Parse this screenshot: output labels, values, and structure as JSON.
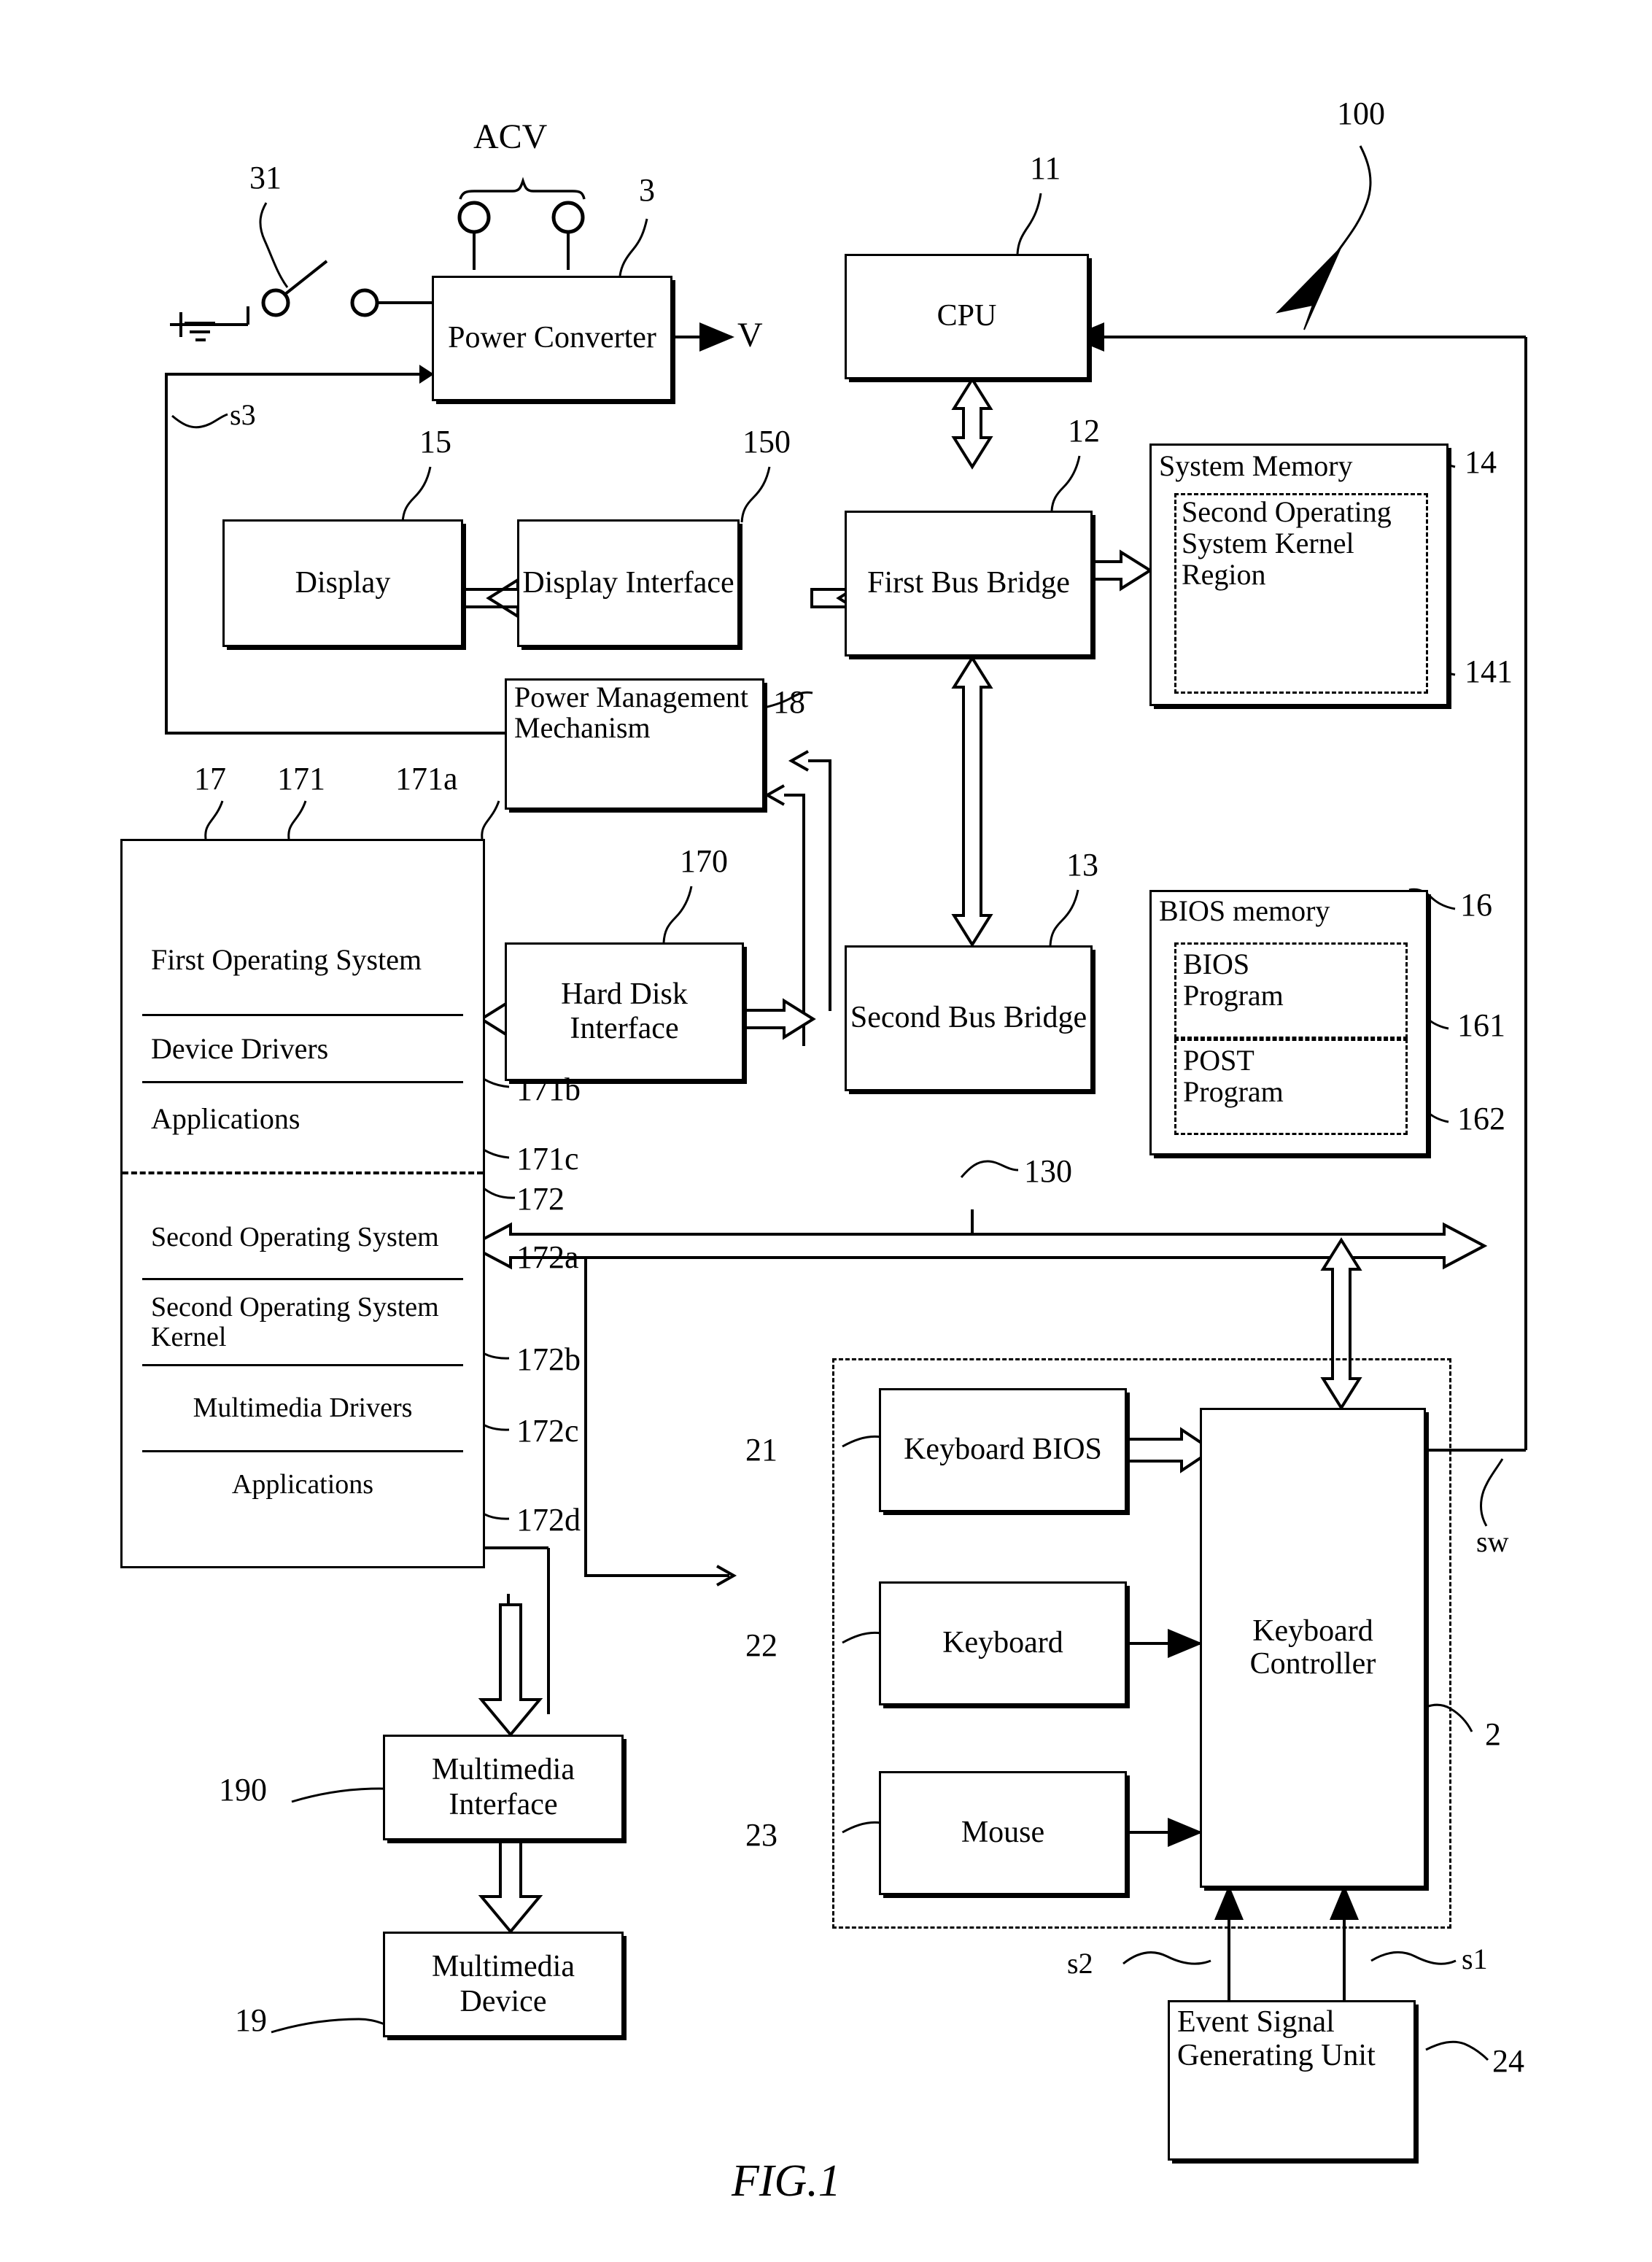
{
  "figure": {
    "caption": "FIG.1",
    "overall_ref": "100"
  },
  "power_section": {
    "acv_label": "ACV",
    "switch_ref": "31",
    "power_converter": {
      "label": "Power Converter",
      "ref": "3"
    },
    "output_label": "V",
    "signal_s3": "s3"
  },
  "core": {
    "cpu": {
      "label": "CPU",
      "ref": "11"
    },
    "first_bus_bridge": {
      "label": "First Bus Bridge",
      "ref": "12"
    },
    "second_bus_bridge": {
      "label": "Second Bus Bridge",
      "ref": "13"
    },
    "bus_130_ref": "130"
  },
  "memory": {
    "system_memory": {
      "label": "System Memory",
      "ref": "14"
    },
    "second_os_kernel_region": {
      "label": "Second Operating System Kernel Region",
      "ref": "141"
    },
    "bios_memory": {
      "label": "BIOS memory",
      "ref": "16"
    },
    "bios_program": {
      "label": "BIOS Program",
      "ref": "161"
    },
    "post_program": {
      "label": "POST Program",
      "ref": "162"
    }
  },
  "display_section": {
    "display": {
      "label": "Display",
      "ref": "15"
    },
    "display_interface": {
      "label": "Display Interface",
      "ref": "150"
    }
  },
  "power_mgmt": {
    "label": "Power Management Mechanism",
    "ref": "18"
  },
  "storage": {
    "hard_disk_interface": {
      "label": "Hard Disk Interface",
      "ref": "170"
    }
  },
  "hard_disk": {
    "ref": "17",
    "first_os_group_ref": "171",
    "second_os_group_ref": "172",
    "first_os": {
      "label": "First Operating System",
      "ref": "171a"
    },
    "first_os_drivers": {
      "label": "Device Drivers",
      "ref": "171b"
    },
    "first_os_apps": {
      "label": "Applications",
      "ref": "171c"
    },
    "second_os": {
      "label": "Second Operating System",
      "ref": "172a"
    },
    "second_os_kernel": {
      "label": "Second Operating System Kernel",
      "ref": "172b"
    },
    "multimedia_drivers": {
      "label": "Multimedia Drivers",
      "ref": "172c"
    },
    "second_os_apps": {
      "label": "Applications",
      "ref": "172d"
    }
  },
  "multimedia": {
    "interface": {
      "label": "Multimedia Interface",
      "ref": "190"
    },
    "device": {
      "label": "Multimedia Device",
      "ref": "19"
    }
  },
  "input_section": {
    "group_ref": "2",
    "keyboard_bios": {
      "label": "Keyboard BIOS",
      "ref": "21"
    },
    "keyboard": {
      "label": "Keyboard",
      "ref": "22"
    },
    "mouse": {
      "label": "Mouse",
      "ref": "23"
    },
    "keyboard_controller": {
      "label": "Keyboard Controller"
    },
    "event_signal_unit": {
      "label": "Event Signal Generating Unit",
      "ref": "24"
    },
    "signal_s1": "s1",
    "signal_s2": "s2",
    "signal_sw": "sw"
  }
}
